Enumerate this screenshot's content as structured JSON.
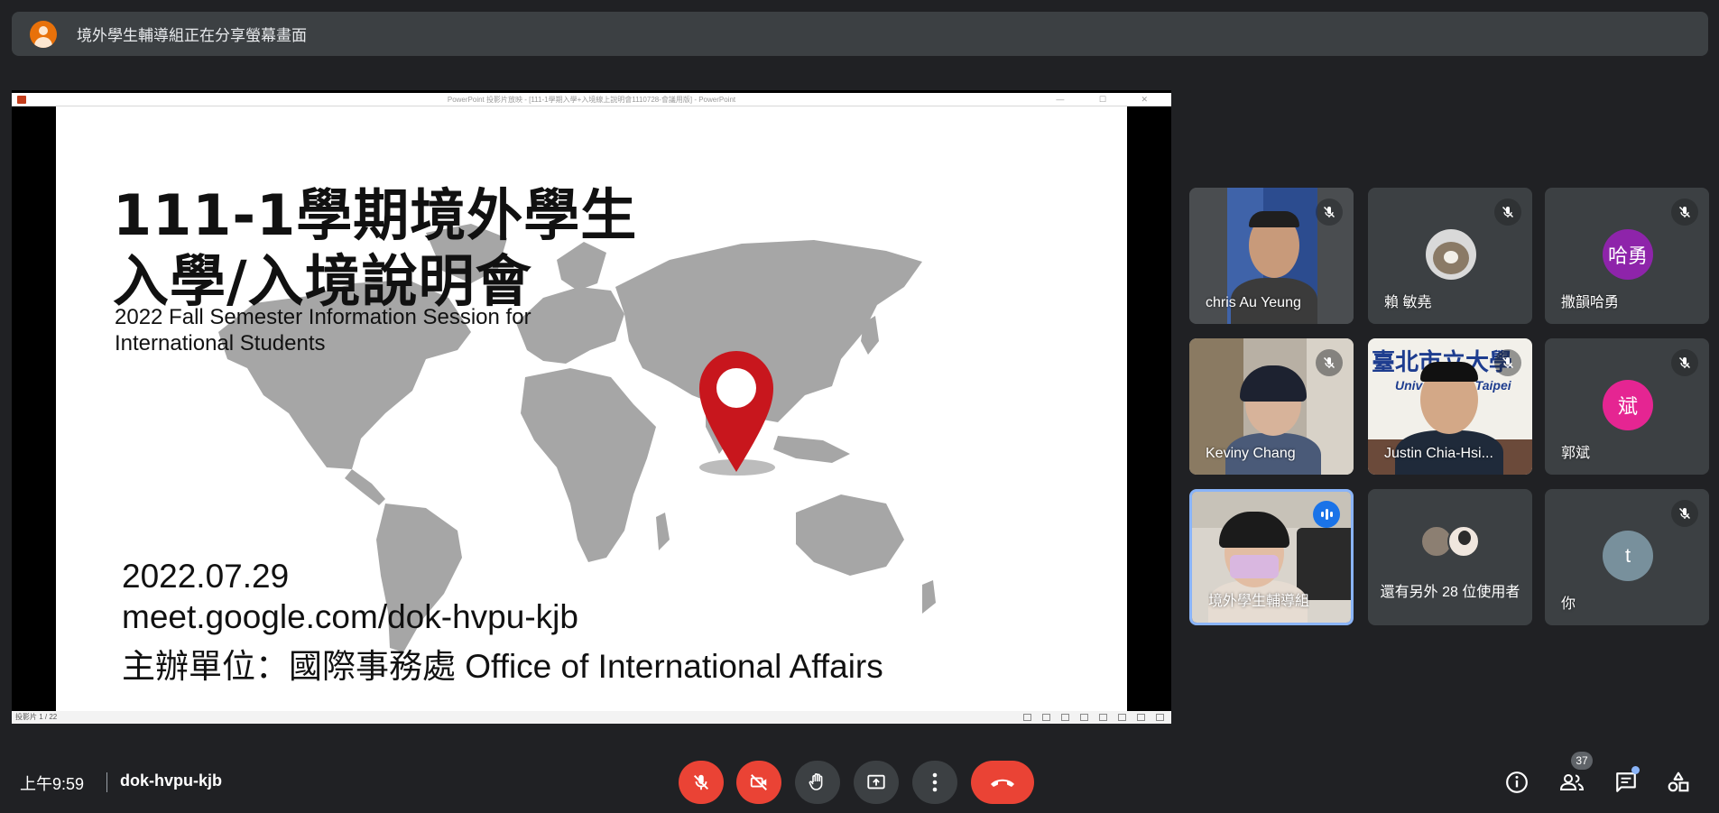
{
  "banner": {
    "text": "境外學生輔導組正在分享螢幕畫面"
  },
  "presentation": {
    "window_title": "PowerPoint 投影片放映 - [111-1學期入學+入境線上說明會1110728-會議用版] - PowerPoint",
    "window_controls": "— ☐ ✕",
    "slide": {
      "title_line1": "111-1學期境外學生",
      "title_line2": "入學/入境說明會",
      "subtitle": "2022 Fall Semester Information Session for\nInternational  Students",
      "date": "2022.07.29",
      "link": "meet.google.com/dok-hvpu-kjb",
      "organizer": "主辦單位：國際事務處 Office of International Affairs"
    },
    "status": "投影片 1 / 22"
  },
  "participants": [
    {
      "name": "chris Au Yeung",
      "muted": true,
      "type": "video"
    },
    {
      "name": "賴 敏堯",
      "muted": true,
      "type": "photo"
    },
    {
      "name": "撒韻哈勇",
      "muted": true,
      "type": "avatar",
      "initial": "哈勇",
      "color": "#8e24aa"
    },
    {
      "name": "Keviny Chang",
      "muted": true,
      "type": "video"
    },
    {
      "name": "Justin Chia-Hsi...",
      "muted": true,
      "type": "video",
      "backdrop_text": "臺北市立大學",
      "backdrop_sub": "University of Taipei"
    },
    {
      "name": "郭斌",
      "muted": true,
      "type": "avatar",
      "initial": "斌",
      "color": "#e52592"
    },
    {
      "name": "境外學生輔導組",
      "muted": false,
      "speaking": true,
      "type": "video"
    },
    {
      "name": "",
      "type": "others",
      "others_text": "還有另外 28 位使用者"
    },
    {
      "name": "你",
      "muted": true,
      "type": "avatar",
      "initial": "t",
      "color": "#78909c"
    }
  ],
  "bottom_bar": {
    "time": "上午9:59",
    "meeting_code": "dok-hvpu-kjb",
    "people_count": "37"
  },
  "colors": {
    "background": "#202124",
    "tile": "#3c4043",
    "danger": "#ea4335",
    "accent": "#8ab4f8",
    "pin": "#c8161d"
  },
  "icons": [
    "mic-off-icon",
    "camera-off-icon",
    "raise-hand-icon",
    "present-icon",
    "more-options-icon",
    "end-call-icon",
    "info-icon",
    "people-icon",
    "chat-icon",
    "activities-icon"
  ]
}
